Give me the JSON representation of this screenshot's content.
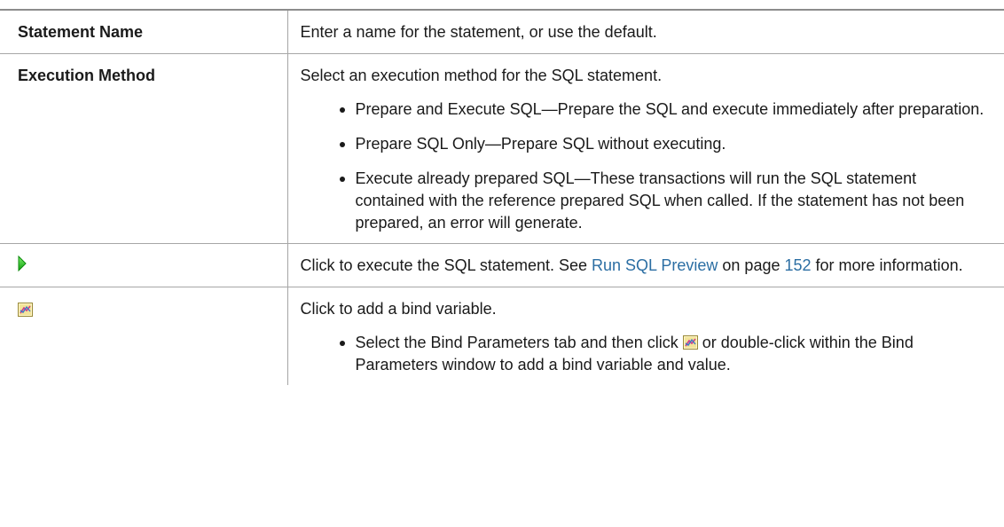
{
  "rows": {
    "statement_name": {
      "label": "Statement Name",
      "description": "Enter a name for the statement, or use the default."
    },
    "execution_method": {
      "label": "Execution Method",
      "description": "Select an execution method for the SQL statement.",
      "options": [
        "Prepare and Execute SQL—Prepare the SQL and execute immediately after preparation.",
        "Prepare SQL Only—Prepare SQL without executing.",
        "Execute already prepared SQL—These transactions will run the SQL statement contained with the reference prepared SQL when called. If the statement has not been prepared, an error will generate."
      ]
    },
    "execute": {
      "icon": "green-play-icon",
      "text_before": "Click to execute the SQL statement. See ",
      "link_text": "Run SQL Preview",
      "text_middle": " on page ",
      "page_link": "152",
      "text_after": " for more information."
    },
    "bind_variable": {
      "icon": "bind-variable-icon",
      "description": "Click to add a bind variable.",
      "step_before": "Select the Bind Parameters tab and then click ",
      "step_after": " or double-click within the Bind Parameters window to add a bind variable and value."
    }
  },
  "colors": {
    "link": "#2b6ea3",
    "rule": "#a6a6a6",
    "play_icon": "#22c022"
  }
}
